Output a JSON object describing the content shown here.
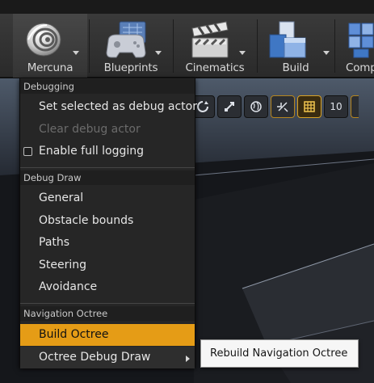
{
  "toolbar": {
    "buttons": [
      {
        "label": "Mercuna",
        "icon": "mercuna-icon"
      },
      {
        "label": "Blueprints",
        "icon": "blueprints-icon"
      },
      {
        "label": "Cinematics",
        "icon": "cinematics-icon"
      },
      {
        "label": "Build",
        "icon": "build-icon"
      },
      {
        "label": "Comp",
        "icon": "compile-icon"
      }
    ]
  },
  "viewport": {
    "toolbar": {
      "icons": [
        "rotate-icon",
        "scale-icon",
        "world-icon",
        "surface-snap-icon",
        "grid-snap-icon"
      ],
      "grid_value": "10"
    }
  },
  "menu": {
    "sections": [
      {
        "header": "Debugging",
        "items": [
          {
            "label": "Set selected as debug actor"
          },
          {
            "label": "Clear debug actor",
            "disabled": true
          },
          {
            "label": "Enable full logging",
            "checkbox": true,
            "checked": false
          }
        ]
      },
      {
        "header": "Debug Draw",
        "items": [
          {
            "label": "General"
          },
          {
            "label": "Obstacle bounds"
          },
          {
            "label": "Paths"
          },
          {
            "label": "Steering"
          },
          {
            "label": "Avoidance"
          }
        ]
      },
      {
        "header": "Navigation Octree",
        "items": [
          {
            "label": "Build Octree",
            "highlighted": true
          },
          {
            "label": "Octree Debug Draw",
            "submenu": true
          }
        ]
      }
    ]
  },
  "submenu": {
    "items": [
      {
        "label": "Rebuild Navigation Octree"
      }
    ]
  },
  "colors": {
    "accent": "#e59c16",
    "menu_bg": "#262626",
    "submenu_bg": "#f6f6f6"
  }
}
